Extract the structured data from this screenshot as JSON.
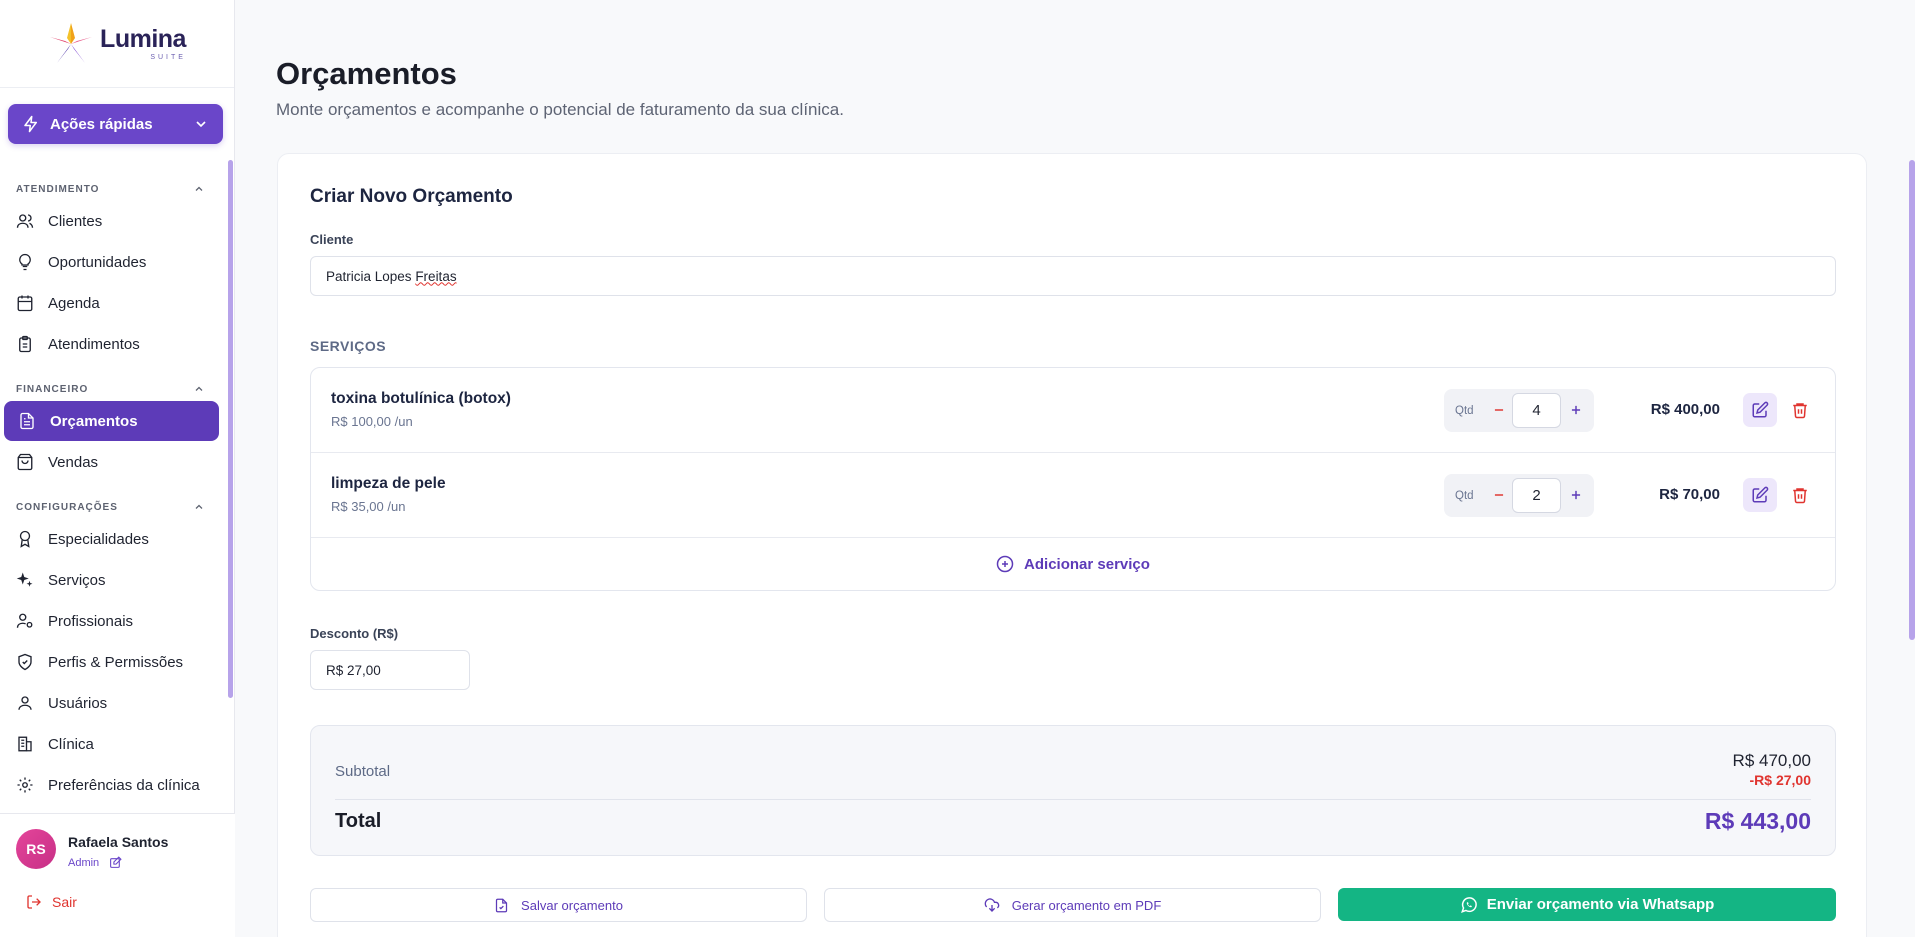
{
  "brand": {
    "name": "Lumina",
    "sub": "SUITE"
  },
  "quick_actions": {
    "label": "Ações rápidas"
  },
  "nav": {
    "sections": [
      {
        "title": "ATENDIMENTO",
        "items": [
          {
            "label": "Clientes",
            "icon": "users-icon"
          },
          {
            "label": "Oportunidades",
            "icon": "lightbulb-icon"
          },
          {
            "label": "Agenda",
            "icon": "calendar-icon"
          },
          {
            "label": "Atendimentos",
            "icon": "clipboard-icon"
          }
        ]
      },
      {
        "title": "FINANCEIRO",
        "items": [
          {
            "label": "Orçamentos",
            "icon": "file-text-icon",
            "active": true
          },
          {
            "label": "Vendas",
            "icon": "shopping-bag-icon"
          }
        ]
      },
      {
        "title": "CONFIGURAÇÕES",
        "items": [
          {
            "label": "Especialidades",
            "icon": "award-icon"
          },
          {
            "label": "Serviços",
            "icon": "sparkles-icon"
          },
          {
            "label": "Profissionais",
            "icon": "user-cog-icon"
          },
          {
            "label": "Perfis & Permissões",
            "icon": "shield-icon"
          },
          {
            "label": "Usuários",
            "icon": "user-icon"
          },
          {
            "label": "Clínica",
            "icon": "building-icon"
          },
          {
            "label": "Preferências da clínica",
            "icon": "settings-icon"
          }
        ]
      }
    ]
  },
  "user": {
    "initials": "RS",
    "name": "Rafaela Santos",
    "role": "Admin",
    "logout": "Sair"
  },
  "page": {
    "title": "Orçamentos",
    "subtitle": "Monte orçamentos e acompanhe o potencial de faturamento da sua clínica."
  },
  "form": {
    "title": "Criar Novo Orçamento",
    "client_label": "Cliente",
    "client_first": "Patricia Lopes ",
    "client_last": "Freitas",
    "services_label": "SERVIÇOS",
    "qty_label": "Qtd",
    "services": [
      {
        "name": "toxina botulínica (botox)",
        "unit_price": "R$ 100,00 /un",
        "qty": "4",
        "total": "R$ 400,00"
      },
      {
        "name": "limpeza de pele",
        "unit_price": "R$ 35,00 /un",
        "qty": "2",
        "total": "R$ 70,00"
      }
    ],
    "add_service": "Adicionar serviço",
    "discount_label": "Desconto (R$)",
    "discount_value": "R$ 27,00"
  },
  "summary": {
    "subtotal_label": "Subtotal",
    "subtotal": "R$ 470,00",
    "discount": "-R$ 27,00",
    "total_label": "Total",
    "total": "R$ 443,00"
  },
  "actions": {
    "save": "Salvar orçamento",
    "pdf": "Gerar orçamento em PDF",
    "whatsapp": "Enviar orçamento via Whatsapp"
  },
  "colors": {
    "accent": "#5d3bb8",
    "danger": "#e0342f",
    "success": "#14b584"
  }
}
